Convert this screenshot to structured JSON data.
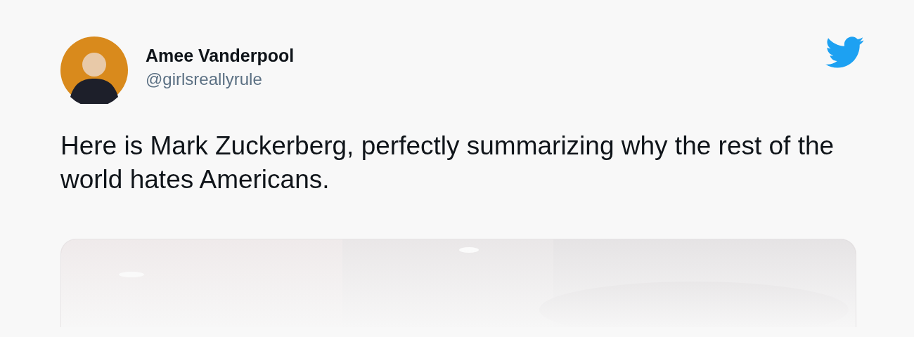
{
  "author": {
    "name": "Amee Vanderpool",
    "handle": "@girlsreallyrule"
  },
  "tweet": {
    "text": "Here is Mark Zuckerberg, perfectly summarizing why the rest of the world hates Americans."
  }
}
